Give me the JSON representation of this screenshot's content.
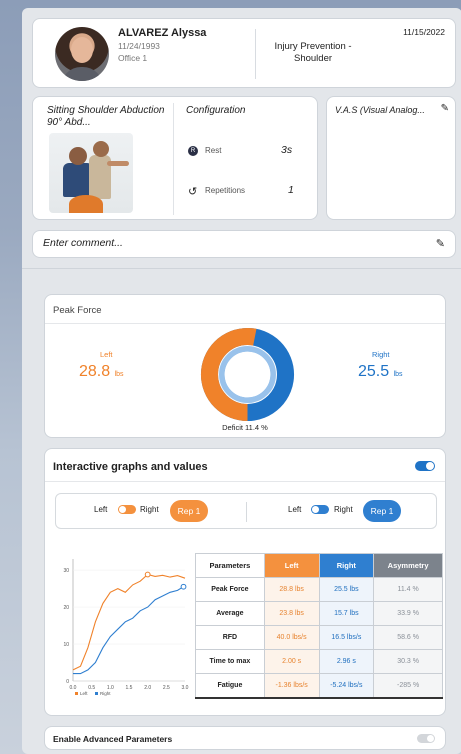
{
  "patient": {
    "name": "ALVAREZ Alyssa",
    "dob": "11/24/1993",
    "office": "Office 1",
    "program": "Injury Prevention - Shoulder",
    "date": "11/15/2022"
  },
  "exercise": {
    "name": "Sitting Shoulder Abduction 90° Abd...",
    "config_label": "Configuration",
    "rest_icon": "R",
    "rest_label": "Rest",
    "rest_value": "3s",
    "rep_label": "Repetitions",
    "rep_value": "1"
  },
  "vas": {
    "label": "V.A.S (Visual Analog..."
  },
  "comment": {
    "placeholder": "Enter comment..."
  },
  "peak_force": {
    "title": "Peak Force",
    "left_label": "Left",
    "left_value": "28.8",
    "left_unit": "lbs",
    "right_label": "Right",
    "right_value": "25.5",
    "right_unit": "lbs",
    "deficit": "Deficit 11.4 %",
    "left_fraction": 0.53,
    "colors": {
      "left": "#f0822a",
      "right": "#1f73c6",
      "inner": "#7fb3e6"
    }
  },
  "interactive": {
    "title": "Interactive graphs and values",
    "group1": {
      "left": "Left",
      "right": "Right",
      "rep": "Rep 1"
    },
    "group2": {
      "left": "Left",
      "right": "Right",
      "rep": "Rep 1"
    }
  },
  "chart_data": {
    "type": "line",
    "title": "",
    "xlabel": "",
    "ylabel": "",
    "xlim": [
      0,
      3.0
    ],
    "ylim": [
      0,
      33
    ],
    "xticks": [
      "0.0",
      "0.5",
      "1.0",
      "1.5",
      "2.0",
      "2.5",
      "3.0"
    ],
    "yticks": [
      0,
      10,
      20,
      30
    ],
    "legend": [
      "Left",
      "Right"
    ],
    "series": [
      {
        "name": "Left",
        "color": "#f0822a",
        "x": [
          0,
          0.2,
          0.4,
          0.6,
          0.8,
          1.0,
          1.2,
          1.4,
          1.6,
          1.8,
          2.0,
          2.2,
          2.4,
          2.6,
          2.8,
          3.0
        ],
        "y": [
          3,
          4,
          9,
          16,
          21,
          24,
          25,
          24,
          26,
          27,
          28.8,
          28.3,
          28.6,
          28.1,
          28.5,
          27.8
        ],
        "peak": [
          2.0,
          28.8
        ]
      },
      {
        "name": "Right",
        "color": "#2f7fd0",
        "x": [
          0,
          0.2,
          0.4,
          0.6,
          0.8,
          1.0,
          1.2,
          1.4,
          1.6,
          1.8,
          2.0,
          2.2,
          2.4,
          2.6,
          2.8,
          2.96
        ],
        "y": [
          2,
          2,
          3,
          5,
          9,
          12,
          14,
          16,
          17,
          19,
          20,
          22,
          23,
          24,
          24.5,
          25.5
        ],
        "peak": [
          2.96,
          25.5
        ]
      }
    ]
  },
  "params_table": {
    "headers": [
      "Parameters",
      "Left",
      "Right",
      "Asymmetry"
    ],
    "rows": [
      [
        "Peak Force",
        "28.8 lbs",
        "25.5 lbs",
        "11.4 %"
      ],
      [
        "Average",
        "23.8 lbs",
        "15.7 lbs",
        "33.9 %"
      ],
      [
        "RFD",
        "40.0 lbs/s",
        "16.5 lbs/s",
        "58.6 %"
      ],
      [
        "Time to max",
        "2.00 s",
        "2.96 s",
        "30.3 %"
      ],
      [
        "Fatigue",
        "-1.36 lbs/s",
        "-5.24 lbs/s",
        "-285 %"
      ]
    ]
  },
  "advanced": {
    "label": "Enable Advanced Parameters"
  },
  "icons": {
    "edit": "pencil-icon",
    "repetitions": "repeat-icon"
  }
}
